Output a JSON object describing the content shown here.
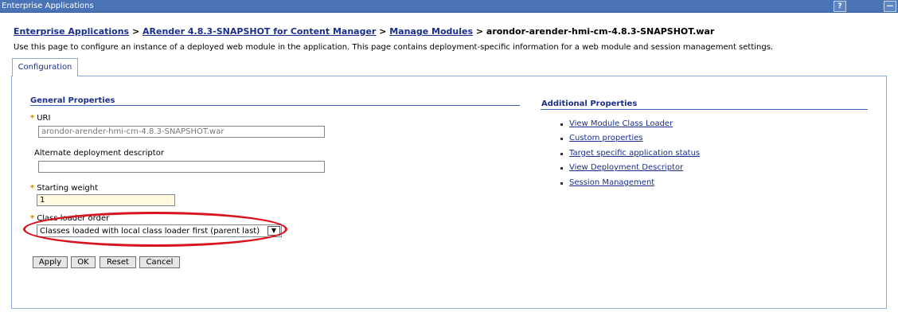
{
  "window": {
    "title": "Enterprise Applications",
    "help_label": "?",
    "close_label": "—"
  },
  "breadcrumb": {
    "items": [
      "Enterprise Applications",
      "ARender 4.8.3-SNAPSHOT for Content Manager",
      "Manage Modules"
    ],
    "separator": " > ",
    "current": "arondor-arender-hmi-cm-4.8.3-SNAPSHOT.war"
  },
  "description": "Use this page to configure an instance of a deployed web module in the application. This page contains deployment-specific information for a web module and session management settings.",
  "tabs": [
    {
      "label": "Configuration"
    }
  ],
  "general_properties": {
    "title": "General Properties",
    "uri": {
      "label": "URI",
      "value": "arondor-arender-hmi-cm-4.8.3-SNAPSHOT.war"
    },
    "alt_descriptor": {
      "label": "Alternate deployment descriptor",
      "value": ""
    },
    "starting_weight": {
      "label": "Starting weight",
      "value": "1"
    },
    "class_loader_order": {
      "label": "Class loader order",
      "selected": "Classes loaded with local class loader first (parent last)"
    },
    "required_marker": "*"
  },
  "buttons": {
    "apply": "Apply",
    "ok": "OK",
    "reset": "Reset",
    "cancel": "Cancel"
  },
  "additional_properties": {
    "title": "Additional Properties",
    "links": [
      "View Module Class Loader",
      "Custom properties",
      "Target specific application status",
      "View Deployment Descriptor",
      "Session Management"
    ]
  },
  "colors": {
    "titlebar": "#4a74b5",
    "link": "#1a2f8c",
    "highlight": "#d8141f",
    "required": "#c58a00"
  }
}
